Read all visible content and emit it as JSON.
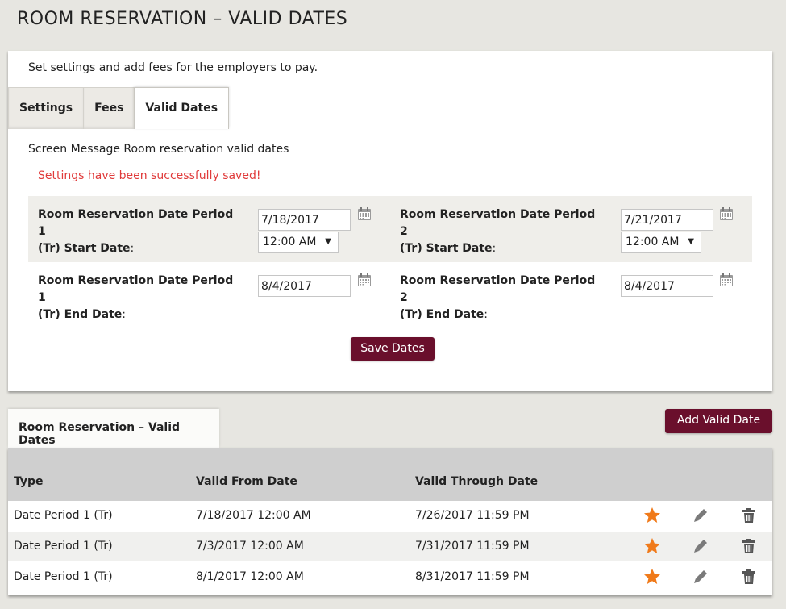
{
  "page": {
    "title": "ROOM RESERVATION – VALID DATES"
  },
  "settings": {
    "description": "Set settings and add fees for the employers to pay.",
    "tabs": [
      {
        "label": "Settings",
        "active": false
      },
      {
        "label": "Fees",
        "active": false
      },
      {
        "label": "Valid Dates",
        "active": true
      }
    ],
    "screen_message": "Screen Message Room reservation valid dates",
    "success_message": "Settings have been successfully saved!",
    "period1": {
      "start_label_line1": "Room Reservation Date Period 1",
      "start_label_line2": "(Tr) Start Date",
      "start_date": "7/18/2017",
      "start_time": "12:00 AM",
      "end_label_line1": "Room Reservation Date Period 1",
      "end_label_line2": "(Tr) End Date",
      "end_date": "8/4/2017"
    },
    "period2": {
      "start_label_line1": "Room Reservation Date Period 2",
      "start_label_line2": "(Tr) Start Date",
      "start_date": "7/21/2017",
      "start_time": "12:00 AM",
      "end_label_line1": "Room Reservation Date Period 2",
      "end_label_line2": "(Tr) End Date",
      "end_date": "8/4/2017"
    },
    "colon": ":",
    "save_button": "Save Dates"
  },
  "list": {
    "tab_label": "Room Reservation – Valid Dates",
    "add_button": "Add Valid Date",
    "columns": [
      "Type",
      "Valid From Date",
      "Valid Through Date"
    ],
    "rows": [
      {
        "type": "Date Period 1 (Tr)",
        "from": "7/18/2017 12:00 AM",
        "through": "7/26/2017 11:59 PM"
      },
      {
        "type": "Date Period 1 (Tr)",
        "from": "7/3/2017 12:00 AM",
        "through": "7/31/2017 11:59 PM"
      },
      {
        "type": "Date Period 1 (Tr)",
        "from": "8/1/2017 12:00 AM",
        "through": "8/31/2017 11:59 PM"
      }
    ],
    "row_icons": [
      "star-icon",
      "pencil-icon",
      "trash-icon"
    ]
  },
  "colors": {
    "brand": "#6a0f2c",
    "success_text": "#e03a3a",
    "star": "#f07a1a",
    "header_bg": "#cfcfcf",
    "page_bg": "#e7e6e1"
  }
}
